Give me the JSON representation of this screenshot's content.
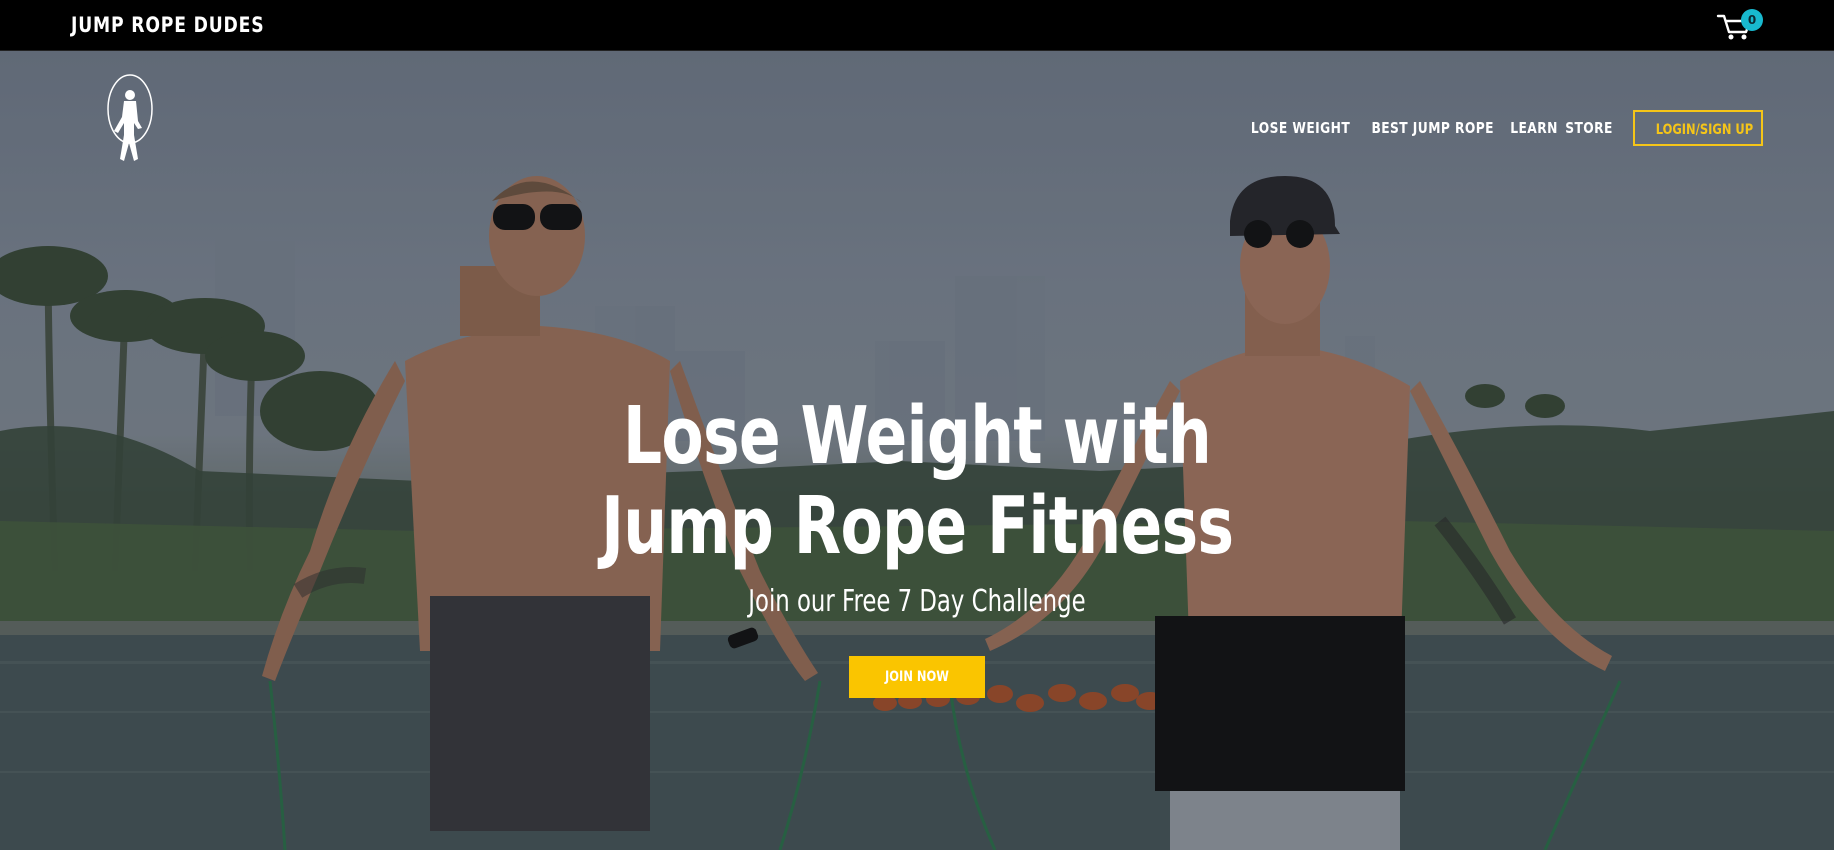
{
  "header": {
    "brand": "JUMP ROPE DUDES",
    "cart_count": "0"
  },
  "nav": {
    "items": [
      {
        "label": "LOSE WEIGHT"
      },
      {
        "label": "BEST JUMP ROPE"
      },
      {
        "label": "LEARN"
      },
      {
        "label": "STORE"
      }
    ],
    "login_label": "LOGIN/SIGN UP"
  },
  "hero": {
    "headline_line1": "Lose Weight with",
    "headline_line2": "Jump Rope Fitness",
    "subheadline": "Join our Free 7 Day Challenge",
    "cta_label": "JOIN NOW"
  },
  "colors": {
    "accent": "#fac500",
    "badge": "#18b9cf",
    "topbar": "#000000"
  },
  "icons": {
    "cart": "shopping-cart-icon",
    "logo": "jump-rope-figure-logo"
  }
}
